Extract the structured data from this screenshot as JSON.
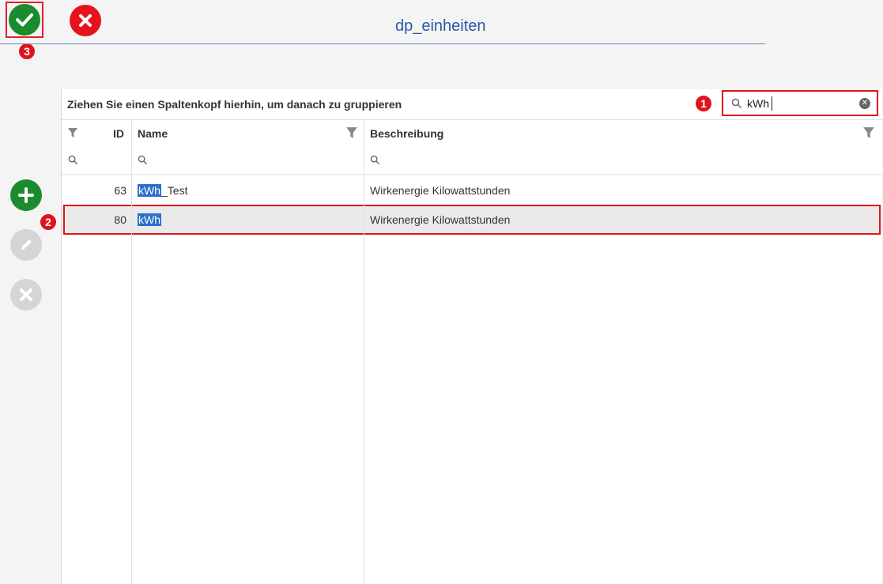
{
  "header": {
    "title": "dp_einheiten"
  },
  "badges": {
    "b1": "1",
    "b2": "2",
    "b3": "3"
  },
  "grid": {
    "group_hint": "Ziehen Sie einen Spaltenkopf hierhin, um danach zu gruppieren",
    "search": {
      "value": "kWh"
    },
    "columns": {
      "id": "ID",
      "name": "Name",
      "description": "Beschreibung"
    },
    "rows": [
      {
        "id": "63",
        "name_highlight": "kWh",
        "name_rest": "_Test",
        "description": "Wirkenergie Kilowattstunden"
      },
      {
        "id": "80",
        "name_highlight": "kWh",
        "name_rest": "",
        "description": "Wirkenergie Kilowattstunden"
      }
    ]
  },
  "colors": {
    "accept": "#1a8c2d",
    "cancel": "#e5141c",
    "highlight": "#2b6ecb",
    "annotation": "#e0141c"
  },
  "icons": [
    "check-icon",
    "close-icon",
    "plus-icon",
    "pencil-icon",
    "x-icon",
    "filter-icon",
    "search-icon",
    "clear-icon"
  ]
}
